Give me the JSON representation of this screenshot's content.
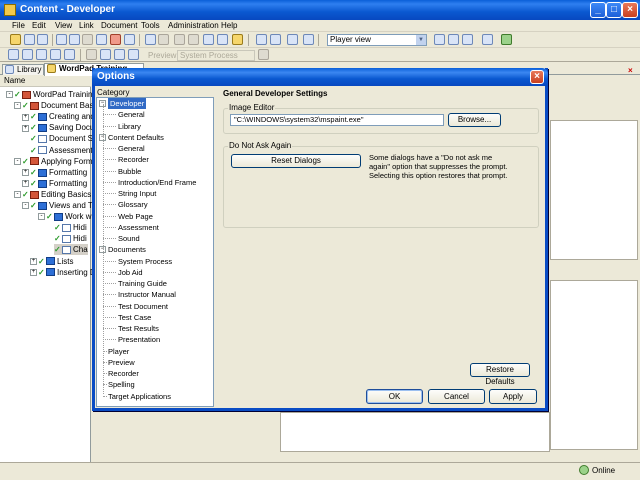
{
  "window": {
    "title": "Content - Developer"
  },
  "menu": [
    "File",
    "Edit",
    "View",
    "Link",
    "Document",
    "Tools",
    "Administration",
    "Help"
  ],
  "toolbar": {
    "player_view": "Player view",
    "preview_label": "Preview:",
    "preview_value": "System Process"
  },
  "tabs": [
    {
      "label": "Library"
    },
    {
      "label": "WordPad Training"
    }
  ],
  "left_panel": {
    "column_header": "Name",
    "tree": [
      "WordPad Training",
      "Document Basics",
      "Creating and",
      "Saving Docu",
      "Document S",
      "Assessment",
      "Applying Forma",
      "Formatting",
      "Formatting",
      "Editing Basics",
      "Views and T",
      "Work wi",
      "Hidi",
      "Hidi",
      "Cha",
      "Lists",
      "Inserting Da"
    ]
  },
  "status": {
    "online": "Online"
  },
  "dialog": {
    "title": "Options",
    "category_label": "Category",
    "categories": [
      {
        "label": "Developer",
        "level": 0,
        "expander": true,
        "selected": true
      },
      {
        "label": "General",
        "level": 1
      },
      {
        "label": "Library",
        "level": 1
      },
      {
        "label": "Content Defaults",
        "level": 0,
        "expander": true
      },
      {
        "label": "General",
        "level": 1
      },
      {
        "label": "Recorder",
        "level": 1
      },
      {
        "label": "Bubble",
        "level": 1
      },
      {
        "label": "Introduction/End Frame",
        "level": 1
      },
      {
        "label": "String Input",
        "level": 1
      },
      {
        "label": "Glossary",
        "level": 1
      },
      {
        "label": "Web Page",
        "level": 1
      },
      {
        "label": "Assessment",
        "level": 1
      },
      {
        "label": "Sound",
        "level": 1
      },
      {
        "label": "Documents",
        "level": 0,
        "expander": true
      },
      {
        "label": "System Process",
        "level": 1
      },
      {
        "label": "Job Aid",
        "level": 1
      },
      {
        "label": "Training Guide",
        "level": 1
      },
      {
        "label": "Instructor Manual",
        "level": 1
      },
      {
        "label": "Test Document",
        "level": 1
      },
      {
        "label": "Test Case",
        "level": 1
      },
      {
        "label": "Test Results",
        "level": 1
      },
      {
        "label": "Presentation",
        "level": 1
      },
      {
        "label": "Player",
        "level": 0
      },
      {
        "label": "Preview",
        "level": 0
      },
      {
        "label": "Recorder",
        "level": 0
      },
      {
        "label": "Spelling",
        "level": 0
      },
      {
        "label": "Target Applications",
        "level": 0
      }
    ],
    "section_title": "General Developer Settings",
    "image_editor": {
      "group_label": "Image Editor",
      "path": "\"C:\\WINDOWS\\system32\\mspaint.exe\"",
      "browse_button": "Browse..."
    },
    "do_not_ask": {
      "group_label": "Do Not Ask Again",
      "reset_button": "Reset Dialogs",
      "note": "Some dialogs have a \"Do not ask me again\" option that suppresses the prompt. Selecting this option restores that prompt."
    },
    "restore_defaults_button": "Restore Defaults",
    "ok_button": "OK",
    "cancel_button": "Cancel",
    "apply_button": "Apply"
  }
}
